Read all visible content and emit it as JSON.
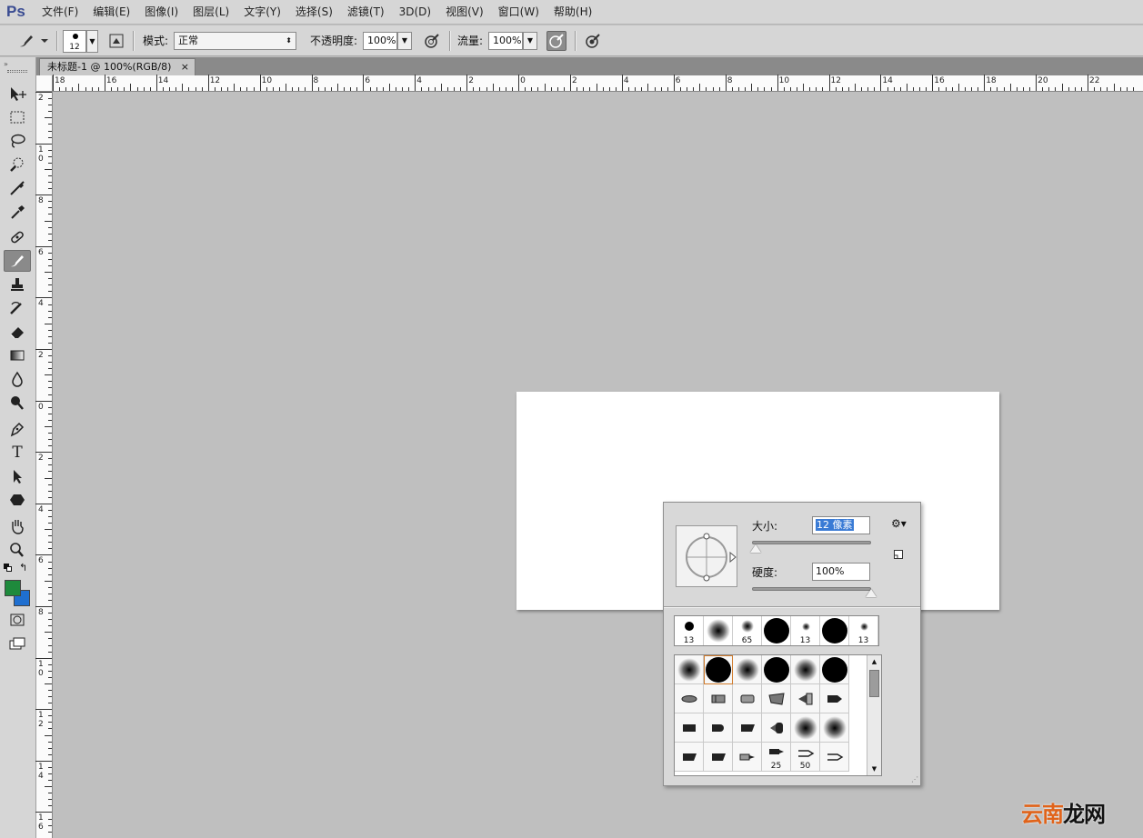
{
  "app": {
    "logo": "Ps",
    "menus": [
      "文件(F)",
      "编辑(E)",
      "图像(I)",
      "图层(L)",
      "文字(Y)",
      "选择(S)",
      "滤镜(T)",
      "3D(D)",
      "视图(V)",
      "窗口(W)",
      "帮助(H)"
    ]
  },
  "options_bar": {
    "brush_size": "12",
    "mode_label": "模式:",
    "mode_value": "正常",
    "opacity_label": "不透明度:",
    "opacity_value": "100%",
    "flow_label": "流量:",
    "flow_value": "100%"
  },
  "document": {
    "tab_title": "未标题-1 @ 100%(RGB/8)",
    "close_glyph": "×"
  },
  "rulers": {
    "horizontal_labels": [
      "18",
      "16",
      "14",
      "12",
      "10",
      "8",
      "6",
      "4",
      "2",
      "0",
      "2",
      "4",
      "6",
      "8",
      "10",
      "12",
      "14",
      "16",
      "18",
      "20",
      "22"
    ],
    "vertical_labels": [
      "2",
      "10",
      "8",
      "6",
      "4",
      "2",
      "0",
      "2",
      "4",
      "6",
      "8",
      "10",
      "12",
      "14",
      "16"
    ]
  },
  "brush_panel": {
    "size_label": "大小:",
    "size_value": "12 像素",
    "size_fraction": 0.03,
    "hardness_label": "硬度:",
    "hardness_value": "100%",
    "hardness_fraction": 1.0,
    "recent_brushes": [
      {
        "label": "13",
        "kind": "hard"
      },
      {
        "label": "",
        "kind": "soft"
      },
      {
        "label": "65",
        "kind": "soft"
      },
      {
        "label": "",
        "kind": "hard"
      },
      {
        "label": "13",
        "kind": "soft"
      },
      {
        "label": "",
        "kind": "hard"
      },
      {
        "label": "13",
        "kind": "soft"
      }
    ],
    "preset_labels": [
      "25",
      "50"
    ]
  },
  "watermark": {
    "part1": "云南",
    "part2": "龙网"
  },
  "colors": {
    "foreground": "#1e8a3c",
    "background": "#1f6fd0",
    "selection_highlight": "#3a7bd5"
  }
}
